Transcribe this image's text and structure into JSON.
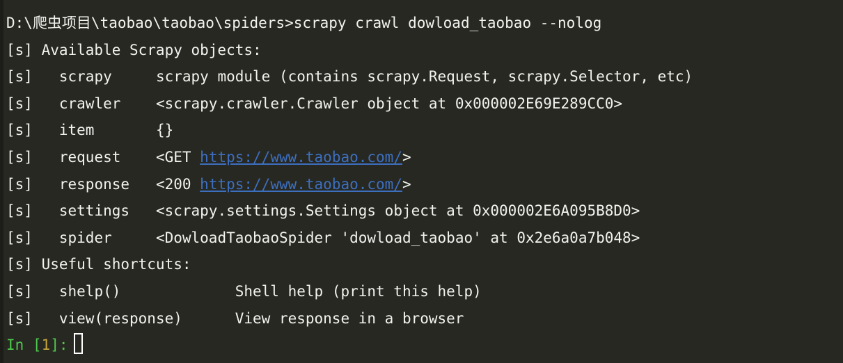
{
  "terminal": {
    "background_color": "#272822",
    "foreground_color": "#f2f2ee",
    "link_color": "#3d6fbf",
    "prompt_name_color": "#4ec94e",
    "prompt_number_color": "#c5a53b",
    "cursor_color": "#ffffff"
  },
  "command_line": {
    "path": "D:\\爬虫项目\\taobao\\taobao\\spiders>",
    "command": "scrapy crawl dowload_taobao --nolog",
    "full": "D:\\爬虫项目\\taobao\\taobao\\spiders>scrapy crawl dowload_taobao --nolog"
  },
  "objects_header": "[s] Available Scrapy objects:",
  "objects": [
    {
      "marker": "[s]",
      "name": "scrapy",
      "name_padded": "   scrapy     ",
      "value_pre": "scrapy module (contains scrapy.Request, scrapy.Selector, etc)",
      "link": "",
      "value_post": ""
    },
    {
      "marker": "[s]",
      "name": "crawler",
      "name_padded": "   crawler    ",
      "value_pre": "<scrapy.crawler.Crawler object at 0x000002E69E289CC0>",
      "link": "",
      "value_post": ""
    },
    {
      "marker": "[s]",
      "name": "item",
      "name_padded": "   item       ",
      "value_pre": "{}",
      "link": "",
      "value_post": ""
    },
    {
      "marker": "[s]",
      "name": "request",
      "name_padded": "   request    ",
      "value_pre": "<GET ",
      "link": "https://www.taobao.com/",
      "value_post": ">"
    },
    {
      "marker": "[s]",
      "name": "response",
      "name_padded": "   response   ",
      "value_pre": "<200 ",
      "link": "https://www.taobao.com/",
      "value_post": ">"
    },
    {
      "marker": "[s]",
      "name": "settings",
      "name_padded": "   settings   ",
      "value_pre": "<scrapy.settings.Settings object at 0x000002E6A095B8D0>",
      "link": "",
      "value_post": ""
    },
    {
      "marker": "[s]",
      "name": "spider",
      "name_padded": "   spider     ",
      "value_pre": "<DowloadTaobaoSpider 'dowload_taobao' at 0x2e6a0a7b048>",
      "link": "",
      "value_post": ""
    }
  ],
  "shortcuts_header": "[s] Useful shortcuts:",
  "shortcuts": [
    {
      "marker": "[s]",
      "name": "shelp()",
      "name_padded": "   shelp()             ",
      "description": "Shell help (print this help)"
    },
    {
      "marker": "[s]",
      "name": "view(response)",
      "name_padded": "   view(response)      ",
      "description": "View response in a browser"
    }
  ],
  "prompt": {
    "name": "In",
    "open_bracket": " [",
    "number": "1",
    "close_bracket": "]",
    "colon": ":",
    "input_value": ""
  }
}
